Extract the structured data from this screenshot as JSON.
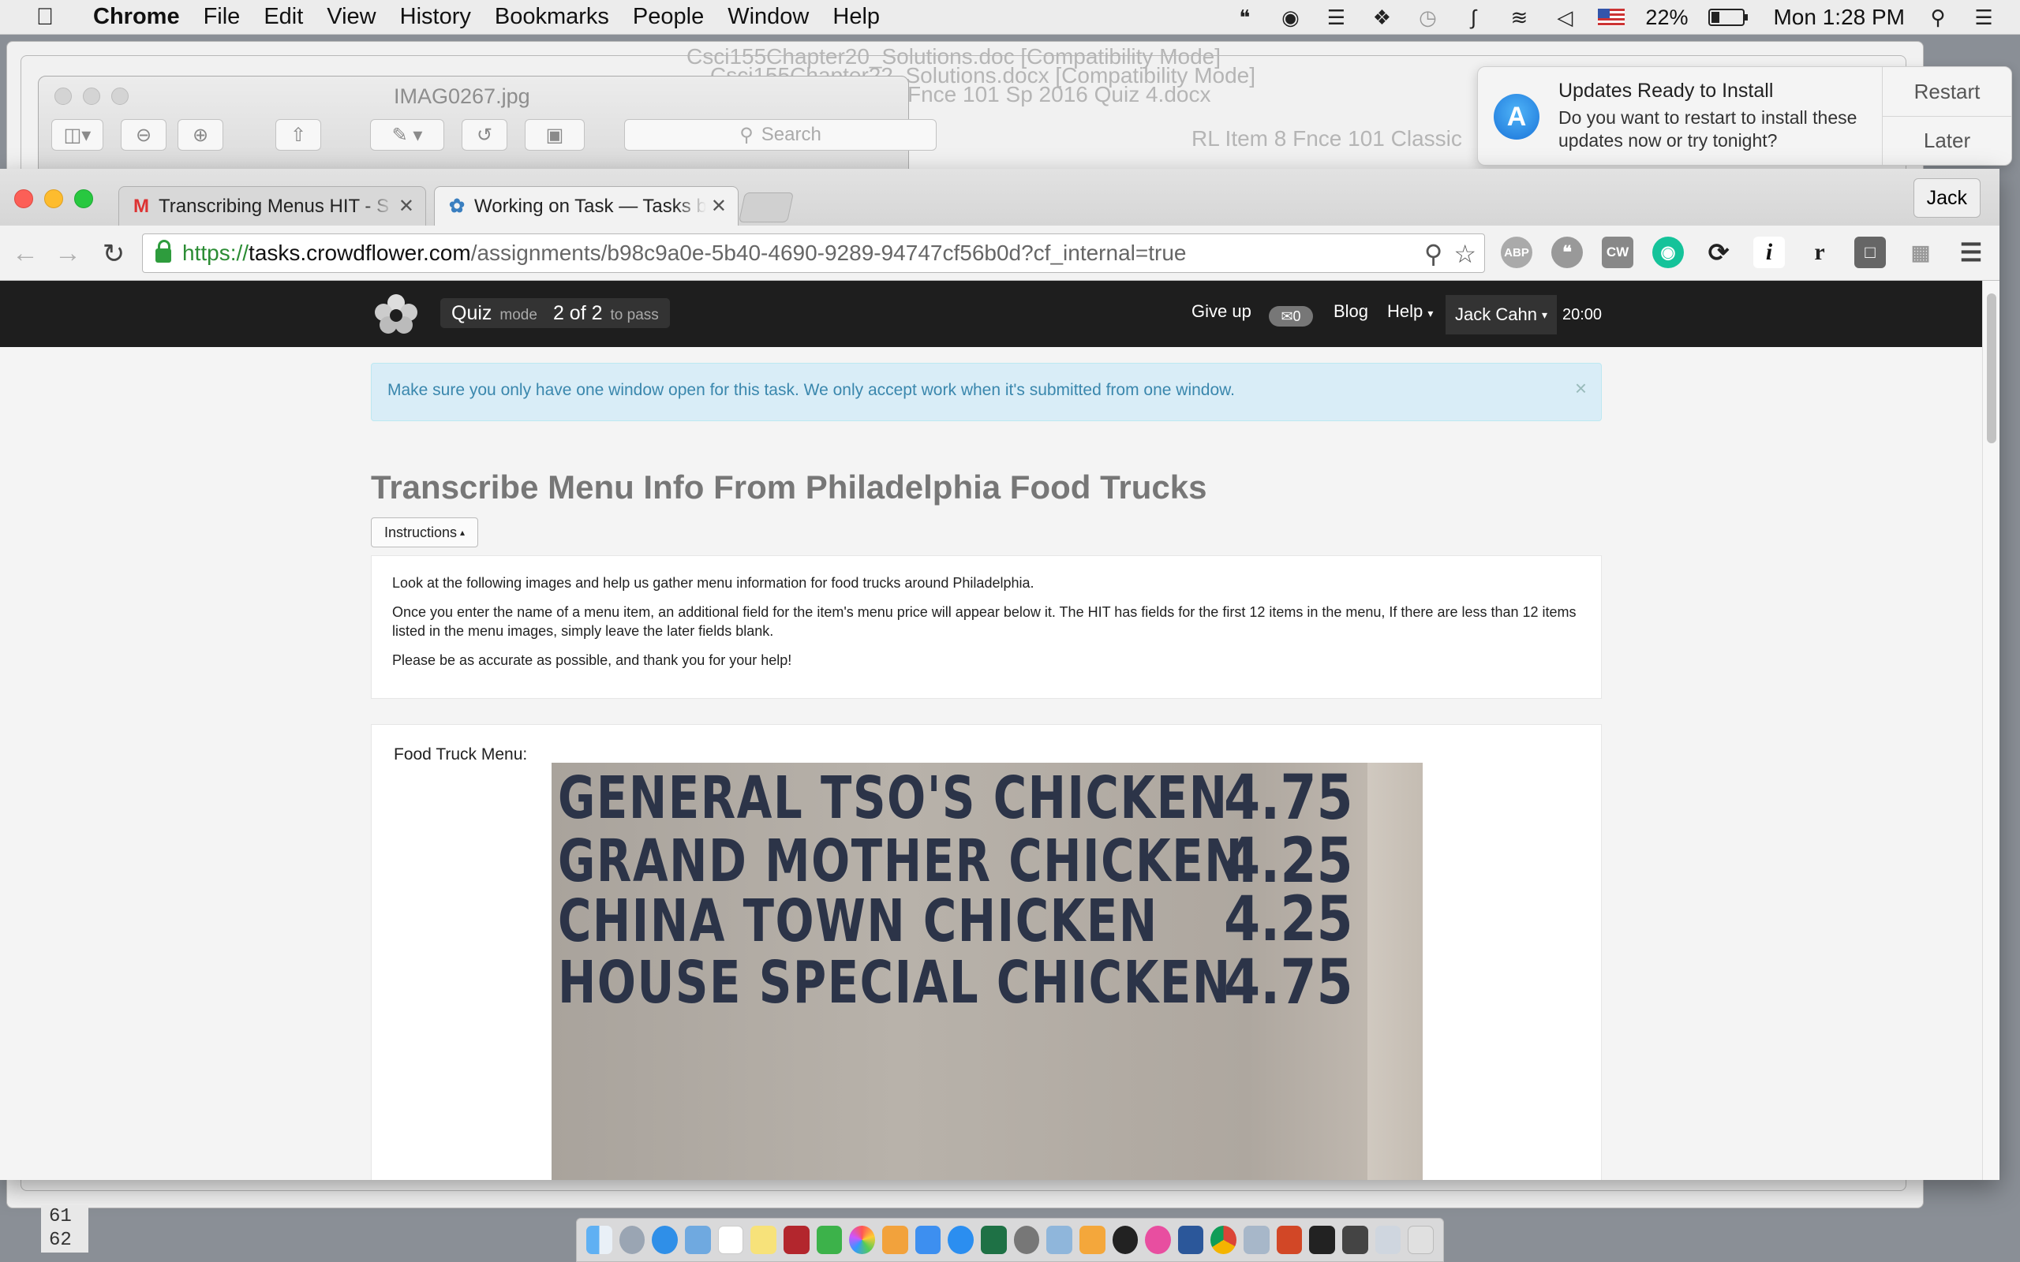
{
  "menubar": {
    "app": "Chrome",
    "items": [
      "File",
      "Edit",
      "View",
      "History",
      "Bookmarks",
      "People",
      "Window",
      "Help"
    ],
    "battery": "22%",
    "clock": "Mon 1:28 PM"
  },
  "background_windows": {
    "titles": [
      "Csci155Chapter20_Solutions.doc [Compatibility Mode]",
      "Csci155Chapter22_Solutions.docx [Compatibility Mode]",
      "Fnce 101 Sp 2016 Quiz 4.docx",
      "RL Item 8 Fnce 101 Classic"
    ],
    "spreadsheet_rows": [
      "61",
      "62"
    ]
  },
  "preview": {
    "title": "IMAG0267.jpg",
    "search_placeholder": "Search"
  },
  "notification": {
    "title": "Updates Ready to Install",
    "body": "Do you want to restart to install these updates now or try tonight?",
    "restart": "Restart",
    "later": "Later"
  },
  "chrome": {
    "tabs": [
      {
        "label": "Transcribing Menus HIT - S",
        "icon": "gmail-icon"
      },
      {
        "label": "Working on Task — Tasks b",
        "icon": "crowdflower-icon"
      }
    ],
    "profile": "Jack",
    "url": {
      "scheme": "https://",
      "host": "tasks.crowdflower.com",
      "path": "/assignments/b98c9a0e-5b40-4690-9289-94747cf56b0d?cf_internal=true"
    },
    "extensions": [
      "ABP",
      "CW",
      "i",
      "r"
    ]
  },
  "cf": {
    "quiz_label": "Quiz",
    "quiz_mode": "mode",
    "quiz_progress": "2 of 2",
    "quiz_suffix": "to pass",
    "nav": {
      "give_up": "Give up",
      "mail_count": "0",
      "blog": "Blog",
      "help": "Help",
      "user": "Jack Cahn",
      "timer": "20:00"
    },
    "alert": "Make sure you only have one window open for this task. We only accept work when it's submitted from one window.",
    "alert_close": "×",
    "title": "Transcribe Menu Info From Philadelphia Food Trucks",
    "instructions_button": "Instructions",
    "instructions": [
      "Look at the following images and help us gather menu information for food trucks around Philadelphia.",
      "Once you enter the name of a menu item, an additional field for the item's menu price will appear below it. The HIT has fields for the first 12 items in the menu, If there are less than 12 items listed in the menu images, simply leave the later fields blank.",
      "Please be as accurate as possible, and thank you for your help!"
    ],
    "menu_label": "Food Truck Menu:",
    "menu_image_rows": [
      {
        "item": "GENERAL TSO'S CHICKEN",
        "price": "4.75"
      },
      {
        "item": "GRAND MOTHER CHICKEN",
        "price": "4.25"
      },
      {
        "item": "CHINA TOWN CHICKEN",
        "price": "4.25"
      },
      {
        "item": "HOUSE SPECIAL CHICKEN",
        "price": "4.75"
      }
    ]
  },
  "colors": {
    "cf_nav": "#1e1e1e",
    "alert_bg": "#d9edf7",
    "alert_text": "#3a87ad",
    "url_green": "#2b8c34",
    "menu_text": "#2c3448"
  }
}
